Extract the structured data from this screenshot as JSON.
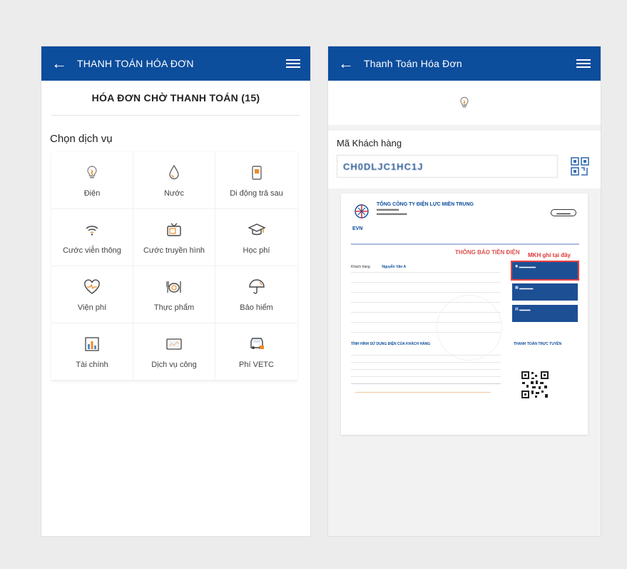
{
  "left": {
    "header": {
      "title": "THANH TOÁN HÓA ĐƠN"
    },
    "pending": "HÓA ĐƠN CHỜ THANH TOÁN (15)",
    "section_title": "Chọn dịch vụ",
    "services": [
      {
        "label": "Điện",
        "icon": "lightbulb-icon"
      },
      {
        "label": "Nước",
        "icon": "water-drop-icon"
      },
      {
        "label": "Di động trả sau",
        "icon": "mobile-postpaid-icon"
      },
      {
        "label": "Cước viễn thông",
        "icon": "wifi-icon"
      },
      {
        "label": "Cước truyền hình",
        "icon": "tv-icon"
      },
      {
        "label": "Học phí",
        "icon": "graduation-cap-icon"
      },
      {
        "label": "Viện phí",
        "icon": "heartbeat-icon"
      },
      {
        "label": "Thực phẩm",
        "icon": "food-icon"
      },
      {
        "label": "Bảo hiểm",
        "icon": "umbrella-icon"
      },
      {
        "label": "Tài chính",
        "icon": "finance-icon"
      },
      {
        "label": "Dịch vụ công",
        "icon": "public-service-icon"
      },
      {
        "label": "Phí VETC",
        "icon": "car-toll-icon"
      }
    ]
  },
  "right": {
    "header": {
      "title": "Thanh Toán Hóa Đơn"
    },
    "customer_label": "Mã Khách hàng",
    "customer_value": "CH0DLJC1HC1J",
    "bill": {
      "company": "TỔNG CÔNG TY ĐIỆN LỰC MIỀN TRUNG",
      "brand": "EVN",
      "notice_title": "THÔNG BÁO TIỀN ĐIỆN",
      "mkh_note": "MKH ghi tại đây",
      "customer_name_label": "Khách hàng",
      "customer_name": "Nguyễn Văn A",
      "usage_title": "TÌNH HÌNH SỬ DỤNG ĐIỆN CỦA KHÁCH HÀNG",
      "pay_title": "THANH TOÁN TRỰC TUYẾN"
    }
  },
  "colors": {
    "primary": "#0c4d9c",
    "accent": "#f08a24",
    "highlight": "#e03535"
  }
}
